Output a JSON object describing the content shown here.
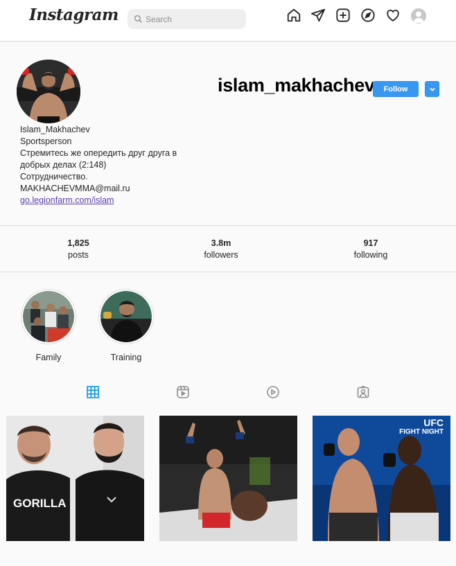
{
  "nav": {
    "logo": "Instagram",
    "search_placeholder": "Search"
  },
  "profile": {
    "username": "islam_makhachev",
    "follow_label": "Follow",
    "full_name": "Islam_Makhachev",
    "category": "Sportsperson",
    "bio_line1": "Стремитесь же опередить друг друга в",
    "bio_line2": "добрых делах (2:148)",
    "bio_line3": "Сотрудничество.",
    "bio_line4": "MAKHACHEVMMA@mail.ru",
    "link": "go.legionfarm.com/islam"
  },
  "stats": [
    {
      "value": "1,825",
      "label": "posts"
    },
    {
      "value": "3.8m",
      "label": "followers"
    },
    {
      "value": "917",
      "label": "following"
    }
  ],
  "highlights": [
    {
      "label": "Family"
    },
    {
      "label": "Training"
    }
  ],
  "tabs": [
    {
      "icon": "grid-icon",
      "active": true
    },
    {
      "icon": "reels-icon",
      "active": false
    },
    {
      "icon": "video-play-icon",
      "active": false
    },
    {
      "icon": "tagged-icon",
      "active": false
    }
  ],
  "posts": [
    {
      "shirt_text": "GORILLA"
    },
    {
      "shirt_text": ""
    },
    {
      "brand": "UFC",
      "event": "FIGHT NIGHT"
    }
  ],
  "colors": {
    "accent": "#3897f0",
    "active_tab": "#0095f6",
    "link": "#5b3fa7"
  }
}
